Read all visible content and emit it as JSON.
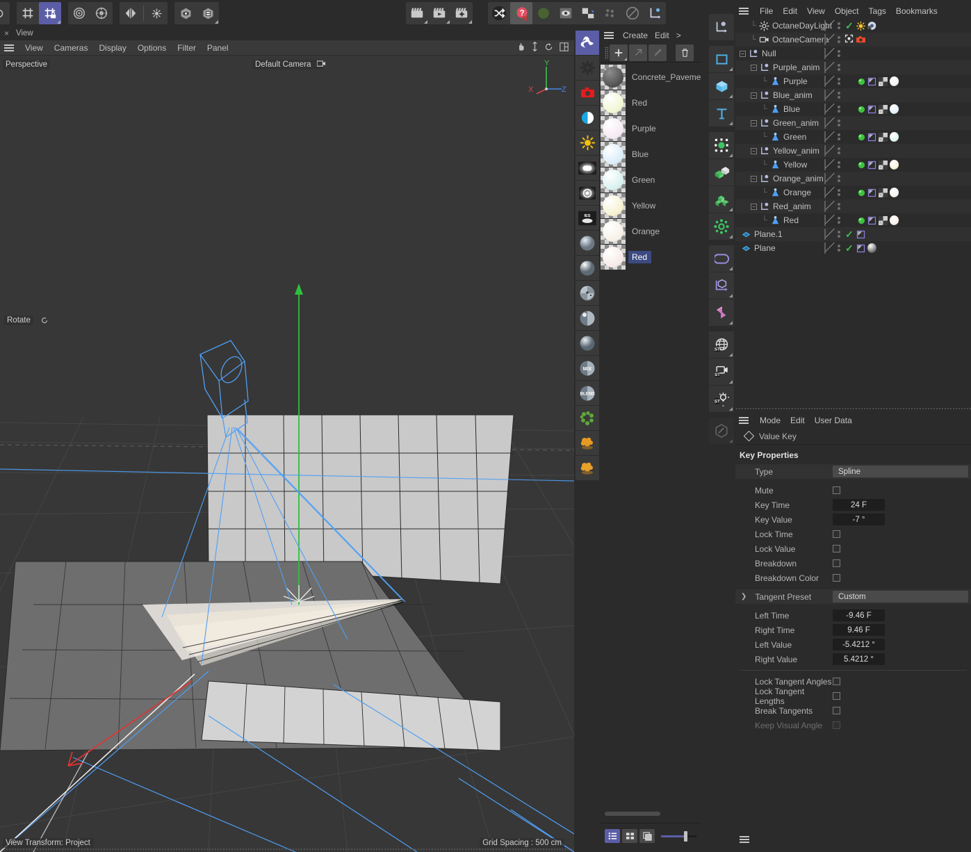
{
  "top_toolbar": {
    "groups": [
      {
        "name": "grid-group",
        "buttons": [
          {
            "name": "grid-icon",
            "active": false,
            "has_sub": false
          },
          {
            "name": "grid-lock-icon",
            "active": true,
            "has_sub": true
          }
        ]
      },
      {
        "name": "snap-group",
        "buttons": [
          {
            "name": "snap-target-icon",
            "active": false,
            "has_sub": false
          },
          {
            "name": "snap-settings-icon",
            "active": false,
            "has_sub": false
          }
        ]
      },
      {
        "name": "symmetry-group",
        "buttons": [
          {
            "name": "symmetry-mirror-icon",
            "active": false,
            "has_sub": false
          },
          {
            "name": "symmetry-settings-icon",
            "active": false,
            "has_sub": false
          }
        ]
      },
      {
        "name": "visibility-group",
        "buttons": [
          {
            "name": "viewport-solo-icon",
            "active": false,
            "has_sub": false
          },
          {
            "name": "layer-manager-icon",
            "active": false,
            "has_sub": true
          }
        ]
      },
      {
        "name": "render-group",
        "buttons": [
          {
            "name": "render-view-icon",
            "active": false,
            "has_sub": true
          },
          {
            "name": "render-picture-viewer-icon",
            "active": false,
            "has_sub": true
          },
          {
            "name": "render-settings-icon",
            "active": false,
            "has_sub": true
          }
        ]
      },
      {
        "name": "octane-group",
        "buttons": [
          {
            "name": "octane-shuffle-icon",
            "active": false,
            "has_sub": false
          },
          {
            "name": "octane-question-icon",
            "active": false,
            "has_sub": false
          },
          {
            "name": "octane-green-icon",
            "active": false,
            "has_sub": false
          },
          {
            "name": "octane-eye-icon",
            "active": false,
            "has_sub": false
          },
          {
            "name": "octane-pin-icon",
            "active": false,
            "has_sub": false
          },
          {
            "name": "octane-particles-icon",
            "active": false,
            "has_sub": false
          },
          {
            "name": "octane-disable-icon",
            "active": false,
            "has_sub": false
          },
          {
            "name": "octane-axis-icon",
            "active": false,
            "has_sub": false
          }
        ]
      }
    ]
  },
  "viewport": {
    "title": "View",
    "close_label": "×",
    "menu": [
      "View",
      "Cameras",
      "Display",
      "Options",
      "Filter",
      "Panel"
    ],
    "right_icons": [
      "pan-icon",
      "dolly-icon",
      "rotate-icon",
      "layout-icon"
    ],
    "label_projection": "Perspective",
    "label_camera": "Default Camera",
    "label_tool": "Rotate",
    "label_view_transform": "View Transform: Project",
    "label_grid_spacing": "Grid Spacing : 500 cm",
    "axis": {
      "x": "X",
      "y": "Y",
      "z": "Z",
      "x_color": "#dd4444",
      "y_color": "#44cc55",
      "z_color": "#4a86e8"
    },
    "colors": {
      "background": "#373737",
      "grid_line": "#4a4a4a",
      "wire_blue": "#4f9ff5",
      "light_line": "#4f9ff5",
      "floor_fill": "#6d6d6d",
      "wall_fill": "#cfcfcf",
      "axis_green": "#2ecc40",
      "axis_red": "#e03030",
      "axis_white": "#eeeeee"
    }
  },
  "octane_shader_bar": {
    "buttons": [
      {
        "name": "octane-live-viewer-icon",
        "active": true,
        "label": ""
      },
      {
        "name": "octane-settings-gear-icon",
        "active": false,
        "label": ""
      },
      {
        "name": "octane-camera-icon",
        "active": false,
        "label": ""
      },
      {
        "name": "octane-imager-icon",
        "active": false,
        "label": ""
      },
      {
        "name": "octane-daylight-icon",
        "active": false,
        "label": ""
      },
      {
        "name": "octane-arealight-icon",
        "active": false,
        "label": ""
      },
      {
        "name": "octane-targetlight-icon",
        "active": false,
        "label": ""
      },
      {
        "name": "octane-ies-light-icon",
        "active": false,
        "label": "IES"
      },
      {
        "name": "octane-diffuse-material-icon",
        "active": false,
        "label": ""
      },
      {
        "name": "octane-glossy-material-icon",
        "active": false,
        "label": ""
      },
      {
        "name": "octane-specular-material-icon",
        "active": false,
        "label": ""
      },
      {
        "name": "octane-metal-material-icon",
        "active": false,
        "label": ""
      },
      {
        "name": "octane-universal-material-icon",
        "active": false,
        "label": ""
      },
      {
        "name": "octane-mix-material-icon",
        "active": false,
        "label": "MIX"
      },
      {
        "name": "octane-blend-material-icon",
        "active": false,
        "label": "BLEND"
      },
      {
        "name": "octane-scatter-icon",
        "active": false,
        "label": ""
      },
      {
        "name": "octane-vdb-volume-icon",
        "active": false,
        "label": ""
      },
      {
        "name": "octane-vectron-icon",
        "active": false,
        "label": ""
      }
    ]
  },
  "material_manager": {
    "menu": [
      "Create",
      "Edit",
      ">"
    ],
    "toolbar": [
      {
        "name": "new-material-button",
        "glyph": "+",
        "dim": false
      },
      {
        "name": "apply-material-button",
        "glyph": "↗",
        "dim": true
      },
      {
        "name": "pick-material-button",
        "glyph": "✐",
        "dim": true
      },
      {
        "name": "delete-material-button",
        "glyph": "🗑",
        "dim": false
      }
    ],
    "materials": [
      {
        "name": "Concrete_Pavement",
        "color": "#4e4e4e",
        "highlight": "#8d8d8d",
        "selected": false
      },
      {
        "name": "Red",
        "color": "#eff6cf",
        "highlight": "#ffffff",
        "selected": false
      },
      {
        "name": "Purple",
        "color": "#f4e9f2",
        "highlight": "#ffffff",
        "selected": false
      },
      {
        "name": "Blue",
        "color": "#d8ecf8",
        "highlight": "#ffffff",
        "selected": false
      },
      {
        "name": "Green",
        "color": "#d5f0ee",
        "highlight": "#ffffff",
        "selected": false
      },
      {
        "name": "Yellow",
        "color": "#f5f0cd",
        "highlight": "#ffffff",
        "selected": false
      },
      {
        "name": "Orange",
        "color": "#f6efe6",
        "highlight": "#ffffff",
        "selected": false
      },
      {
        "name": "Red",
        "color": "#f6e9e6",
        "highlight": "#ffffff",
        "selected": true
      }
    ],
    "view_buttons": [
      {
        "name": "list-view-button",
        "active": true
      },
      {
        "name": "grid-view-button",
        "active": false
      },
      {
        "name": "large-preview-button",
        "active": false
      }
    ]
  },
  "object_toolbar": {
    "buttons": [
      {
        "name": "null-object-icon",
        "has_sub": false,
        "dim": false
      },
      {
        "name": "spline-primitive-icon",
        "has_sub": true,
        "dim": false
      },
      {
        "name": "cube-primitive-icon",
        "has_sub": true,
        "dim": false
      },
      {
        "name": "text-spline-icon",
        "has_sub": true,
        "dim": false
      },
      {
        "name": "nurbs-generator-icon",
        "has_sub": true,
        "dim": false
      },
      {
        "name": "array-object-icon",
        "has_sub": false,
        "dim": false
      },
      {
        "name": "cloner-object-icon",
        "has_sub": true,
        "dim": false
      },
      {
        "name": "mograph-effector-icon",
        "has_sub": true,
        "dim": false
      },
      {
        "name": "deformer-icon",
        "has_sub": true,
        "dim": false
      },
      {
        "name": "field-object-icon",
        "has_sub": true,
        "dim": false
      },
      {
        "name": "dynamics-tag-icon",
        "has_sub": true,
        "dim": false
      },
      {
        "name": "stage-environment-icon",
        "has_sub": true,
        "dim": false
      },
      {
        "name": "stage-camera-icon",
        "has_sub": true,
        "dim": false
      },
      {
        "name": "stage-light-icon",
        "has_sub": true,
        "dim": false
      },
      {
        "name": "paint-tool-icon",
        "has_sub": true,
        "dim": true
      }
    ]
  },
  "object_manager": {
    "menu": [
      "File",
      "Edit",
      "View",
      "Object",
      "Tags",
      "Bookmarks"
    ],
    "rows": [
      {
        "label": "OctaneDayLight",
        "icon": "daylight-icon",
        "depth": 1,
        "expander": "none",
        "check": true,
        "tags": [
          "sun-tag",
          "octane-tag"
        ]
      },
      {
        "label": "OctaneCamera",
        "icon": "camera-icon",
        "depth": 1,
        "expander": "none",
        "check": "move",
        "tags": [
          "camera-red-tag"
        ]
      },
      {
        "label": "Null",
        "icon": "null-icon",
        "depth": 0,
        "expander": "open",
        "check": false,
        "tags": []
      },
      {
        "label": "Purple_anim",
        "icon": "null-icon",
        "depth": 1,
        "expander": "open",
        "check": false,
        "tags": []
      },
      {
        "label": "Purple",
        "icon": "light-icon",
        "depth": 2,
        "expander": "none",
        "check": false,
        "tags": [
          "green-dot",
          "flag-tag",
          "checker-tag",
          "material-tag"
        ],
        "mat_color": "#f6f0f6"
      },
      {
        "label": "Blue_anim",
        "icon": "null-icon",
        "depth": 1,
        "expander": "open",
        "check": false,
        "tags": []
      },
      {
        "label": "Blue",
        "icon": "light-icon",
        "depth": 2,
        "expander": "none",
        "check": false,
        "tags": [
          "green-dot",
          "flag-tag",
          "checker-tag",
          "material-tag"
        ],
        "mat_color": "#dff0fa"
      },
      {
        "label": "Green_anim",
        "icon": "null-icon",
        "depth": 1,
        "expander": "open",
        "check": false,
        "tags": []
      },
      {
        "label": "Green",
        "icon": "light-icon",
        "depth": 2,
        "expander": "none",
        "check": false,
        "tags": [
          "green-dot",
          "flag-tag",
          "checker-tag",
          "material-tag"
        ],
        "mat_color": "#ddf4f0"
      },
      {
        "label": "Yellow_anim",
        "icon": "null-icon",
        "depth": 1,
        "expander": "open",
        "check": false,
        "tags": []
      },
      {
        "label": "Yellow",
        "icon": "light-icon",
        "depth": 2,
        "expander": "none",
        "check": false,
        "tags": [
          "green-dot",
          "flag-tag",
          "checker-tag",
          "material-tag"
        ],
        "mat_color": "#f7f3d8"
      },
      {
        "label": "Orange_anim",
        "icon": "null-icon",
        "depth": 1,
        "expander": "open",
        "check": false,
        "tags": []
      },
      {
        "label": "Orange",
        "icon": "light-icon",
        "depth": 2,
        "expander": "none",
        "check": false,
        "tags": [
          "green-dot",
          "flag-tag",
          "checker-tag",
          "material-tag"
        ],
        "mat_color": "#f8f2ec"
      },
      {
        "label": "Red_anim",
        "icon": "null-icon",
        "depth": 1,
        "expander": "open",
        "check": false,
        "tags": []
      },
      {
        "label": "Red",
        "icon": "light-icon",
        "depth": 2,
        "expander": "none",
        "check": false,
        "tags": [
          "green-dot",
          "flag-tag",
          "checker-tag",
          "material-tag"
        ],
        "mat_color": "#f9eeeb"
      },
      {
        "label": "Plane.1",
        "icon": "plane-icon",
        "depth": 0,
        "expander": "none",
        "check": true,
        "tags": [
          "flag-tag"
        ]
      },
      {
        "label": "Plane",
        "icon": "plane-icon",
        "depth": 0,
        "expander": "none",
        "check": true,
        "tags": [
          "flag-tag",
          "material-tag"
        ],
        "mat_color": "#6b6b6b"
      }
    ]
  },
  "attribute_manager": {
    "menu": [
      "Mode",
      "Edit",
      "User Data"
    ],
    "header": "Value Key",
    "section_title": "Key Properties",
    "type_label": "Type",
    "type_value": "Spline",
    "properties": [
      {
        "label": "Mute",
        "kind": "check",
        "value": false,
        "dim": false
      },
      {
        "label": "Key Time",
        "kind": "field",
        "value": "24 F",
        "dim": false
      },
      {
        "label": "Key Value",
        "kind": "field",
        "value": "-7 °",
        "dim": false
      },
      {
        "label": "Lock Time",
        "kind": "check",
        "value": false,
        "dim": false
      },
      {
        "label": "Lock Value",
        "kind": "check",
        "value": false,
        "dim": false
      },
      {
        "label": "Breakdown",
        "kind": "check",
        "value": false,
        "dim": false
      },
      {
        "label": "Breakdown Color",
        "kind": "check",
        "value": false,
        "dim": false
      }
    ],
    "tangent_preset_label": "Tangent Preset",
    "tangent_preset_value": "Custom",
    "tangent_rows": [
      {
        "label": "Left  Time",
        "kind": "field",
        "value": "-9.46 F"
      },
      {
        "label": "Right Time",
        "kind": "field",
        "value": "9.46 F"
      },
      {
        "label": "Left  Value",
        "kind": "field",
        "value": "-5.4212 °"
      },
      {
        "label": "Right Value",
        "kind": "field",
        "value": "5.4212 °"
      }
    ],
    "tangent_checks": [
      {
        "label": "Lock Tangent Angles",
        "value": false,
        "dim": false
      },
      {
        "label": "Lock Tangent Lengths",
        "value": false,
        "dim": false
      },
      {
        "label": "Break Tangents",
        "value": false,
        "dim": false
      },
      {
        "label": "Keep Visual Angle",
        "value": false,
        "dim": true
      }
    ]
  },
  "colors": {
    "accent": "#5b5ea6",
    "panel_bg": "#2b2b2b",
    "field_bg": "#1e1e1e",
    "text": "#c8c8c8",
    "selection": "#3c4a82",
    "check_green": "#3fbe52",
    "octane_red": "#e84b3a"
  }
}
